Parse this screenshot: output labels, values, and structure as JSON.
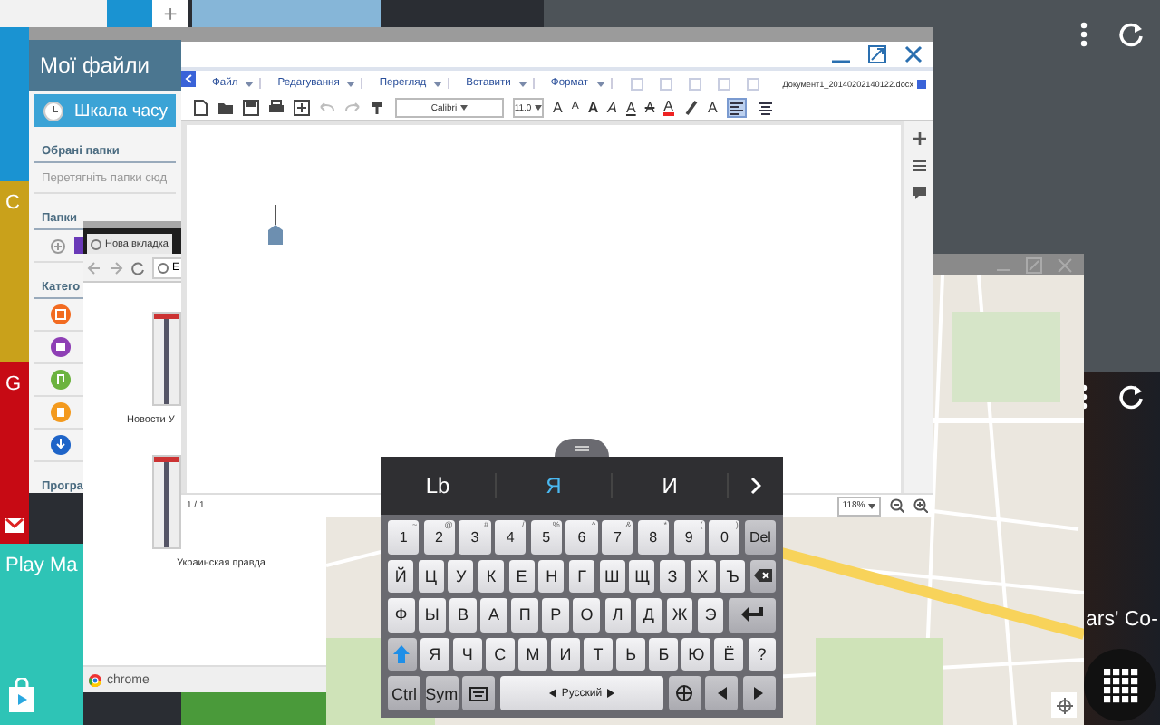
{
  "home": {
    "new_tab": "+",
    "tiles": [
      {
        "kind": "plain",
        "color": "#1a93d2"
      },
      {
        "kind": "plain",
        "label": "C",
        "color": "#c9a11b"
      },
      {
        "kind": "mail",
        "label": "G",
        "color": "#c70a14"
      },
      {
        "kind": "store",
        "label": "Play Ma",
        "color": "#2ec4b6"
      }
    ],
    "side_text": "ars' Co-"
  },
  "files_window": {
    "title": "Мої файли",
    "timeline": "Шкала часу",
    "favorites_heading": "Обрані папки",
    "favorites_hint": "Перетягніть папки сюд",
    "folders_heading": "Папки",
    "categories_heading": "Катего",
    "categories": [
      {
        "kind": "image",
        "color": "#f26b21"
      },
      {
        "kind": "video",
        "color": "#8e3fb5"
      },
      {
        "kind": "music",
        "color": "#6cb33f"
      },
      {
        "kind": "document",
        "color": "#f39a1e"
      },
      {
        "kind": "download",
        "color": "#1e64c8"
      }
    ],
    "apps_heading": "Програ"
  },
  "browser_window": {
    "tab": "Нова вкладка",
    "address": "Е",
    "tiles": [
      {
        "caption": "Новости У"
      },
      {
        "caption": "Украинская правда"
      }
    ],
    "footer": "chrome"
  },
  "document_window": {
    "menu": [
      "Файл",
      "Редагування",
      "Перегляд",
      "Вставити",
      "Формат"
    ],
    "filename": "Документ1_20140202140122.docx",
    "toolbar": [
      {
        "kind": "new",
        "disabled": false
      },
      {
        "kind": "open",
        "disabled": false
      },
      {
        "kind": "save",
        "disabled": false
      },
      {
        "kind": "print",
        "disabled": false
      },
      {
        "kind": "fit",
        "disabled": false
      },
      {
        "kind": "undo",
        "disabled": true
      },
      {
        "kind": "redo",
        "disabled": true
      },
      {
        "kind": "paint",
        "disabled": false
      },
      {
        "kind": "font",
        "value": "Calibri",
        "disabled": false
      },
      {
        "kind": "size",
        "value": "11.0",
        "disabled": false
      },
      {
        "kind": "grow",
        "text": "A",
        "disabled": false
      },
      {
        "kind": "shrink",
        "text": "A",
        "disabled": false
      },
      {
        "kind": "bold",
        "text": "A",
        "disabled": false
      },
      {
        "kind": "italic",
        "text": "A",
        "disabled": false
      },
      {
        "kind": "underline",
        "text": "A",
        "disabled": false
      },
      {
        "kind": "strike",
        "text": "A",
        "disabled": false
      },
      {
        "kind": "color",
        "text": "A",
        "disabled": false
      },
      {
        "kind": "highlight",
        "disabled": false
      },
      {
        "kind": "clear",
        "text": "A",
        "disabled": false
      }
    ],
    "alignment": [
      {
        "kind": "left",
        "selected": true
      },
      {
        "kind": "center",
        "selected": false
      }
    ],
    "page": "1 / 1",
    "zoom": "118%"
  },
  "keyboard": {
    "suggestions": [
      {
        "text": "Lb",
        "selected": false
      },
      {
        "text": "Я",
        "selected": true
      },
      {
        "text": "И",
        "selected": false
      }
    ],
    "number_row": [
      {
        "kind": "char",
        "label": "1",
        "sub": "~"
      },
      {
        "kind": "char",
        "label": "2",
        "sub": "@"
      },
      {
        "kind": "char",
        "label": "3",
        "sub": "#"
      },
      {
        "kind": "char",
        "label": "4",
        "sub": "/"
      },
      {
        "kind": "char",
        "label": "5",
        "sub": "%"
      },
      {
        "kind": "char",
        "label": "6",
        "sub": "^"
      },
      {
        "kind": "char",
        "label": "7",
        "sub": "&"
      },
      {
        "kind": "char",
        "label": "8",
        "sub": "*"
      },
      {
        "kind": "char",
        "label": "9",
        "sub": "("
      },
      {
        "kind": "char",
        "label": "0",
        "sub": ")"
      },
      {
        "kind": "char",
        "label": "Del"
      }
    ],
    "top_row": [
      {
        "kind": "char",
        "label": "Й"
      },
      {
        "kind": "char",
        "label": "Ц"
      },
      {
        "kind": "char",
        "label": "У"
      },
      {
        "kind": "char",
        "label": "К"
      },
      {
        "kind": "char",
        "label": "Е"
      },
      {
        "kind": "char",
        "label": "Н"
      },
      {
        "kind": "char",
        "label": "Г"
      },
      {
        "kind": "char",
        "label": "Ш"
      },
      {
        "kind": "char",
        "label": "Щ"
      },
      {
        "kind": "char",
        "label": "З"
      },
      {
        "kind": "char",
        "label": "Х"
      },
      {
        "kind": "char",
        "label": "Ъ"
      },
      {
        "kind": "backspace"
      }
    ],
    "home_row": [
      {
        "kind": "char",
        "label": "Ф"
      },
      {
        "kind": "char",
        "label": "Ы"
      },
      {
        "kind": "char",
        "label": "В"
      },
      {
        "kind": "char",
        "label": "А"
      },
      {
        "kind": "char",
        "label": "П"
      },
      {
        "kind": "char",
        "label": "Р"
      },
      {
        "kind": "char",
        "label": "О"
      },
      {
        "kind": "char",
        "label": "Л"
      },
      {
        "kind": "char",
        "label": "Д"
      },
      {
        "kind": "char",
        "label": "Ж"
      },
      {
        "kind": "char",
        "label": "Э"
      },
      {
        "kind": "enter"
      }
    ],
    "bottom_row": [
      {
        "kind": "shift"
      },
      {
        "kind": "char",
        "label": "Я"
      },
      {
        "kind": "char",
        "label": "Ч"
      },
      {
        "kind": "char",
        "label": "С"
      },
      {
        "kind": "char",
        "label": "М"
      },
      {
        "kind": "char",
        "label": "И"
      },
      {
        "kind": "char",
        "label": "Т"
      },
      {
        "kind": "char",
        "label": "Ь"
      },
      {
        "kind": "char",
        "label": "Б"
      },
      {
        "kind": "char",
        "label": "Ю"
      },
      {
        "kind": "char",
        "label": "Ё"
      },
      {
        "kind": "char",
        "label": "?"
      }
    ],
    "function_row": [
      {
        "kind": "char",
        "label": "Ctrl"
      },
      {
        "kind": "char",
        "label": "Sym"
      },
      {
        "kind": "settings"
      },
      {
        "kind": "space",
        "label": "Русский"
      },
      {
        "kind": "globe"
      },
      {
        "kind": "left"
      },
      {
        "kind": "right"
      }
    ]
  }
}
